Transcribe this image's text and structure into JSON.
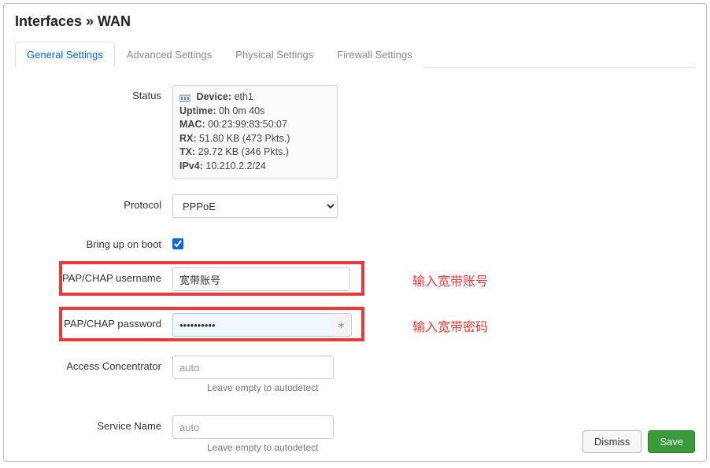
{
  "title": "Interfaces » WAN",
  "tabs": [
    {
      "label": "General Settings",
      "active": true
    },
    {
      "label": "Advanced Settings",
      "active": false
    },
    {
      "label": "Physical Settings",
      "active": false
    },
    {
      "label": "Firewall Settings",
      "active": false
    }
  ],
  "status": {
    "label": "Status",
    "device_label": "Device:",
    "device": "eth1",
    "uptime_label": "Uptime:",
    "uptime": "0h 0m 40s",
    "mac_label": "MAC:",
    "mac": "00:23:99:83:50:07",
    "rx_label": "RX:",
    "rx": "51.80 KB (473 Pkts.)",
    "tx_label": "TX:",
    "tx": "29.72 KB (346 Pkts.)",
    "ipv4_label": "IPv4:",
    "ipv4": "10.210.2.2/24"
  },
  "protocol": {
    "label": "Protocol",
    "value": "PPPoE"
  },
  "bringup": {
    "label": "Bring up on boot",
    "checked": true
  },
  "username": {
    "label": "PAP/CHAP username",
    "value": "宽带账号",
    "annotation": "输入宽带账号"
  },
  "password": {
    "label": "PAP/CHAP password",
    "value": "••••••••••",
    "annotation": "输入宽带密码",
    "reveal": "∗"
  },
  "ac": {
    "label": "Access Concentrator",
    "placeholder": "auto",
    "hint": "Leave empty to autodetect"
  },
  "service": {
    "label": "Service Name",
    "placeholder": "auto",
    "hint": "Leave empty to autodetect"
  },
  "buttons": {
    "dismiss": "Dismiss",
    "save": "Save"
  }
}
